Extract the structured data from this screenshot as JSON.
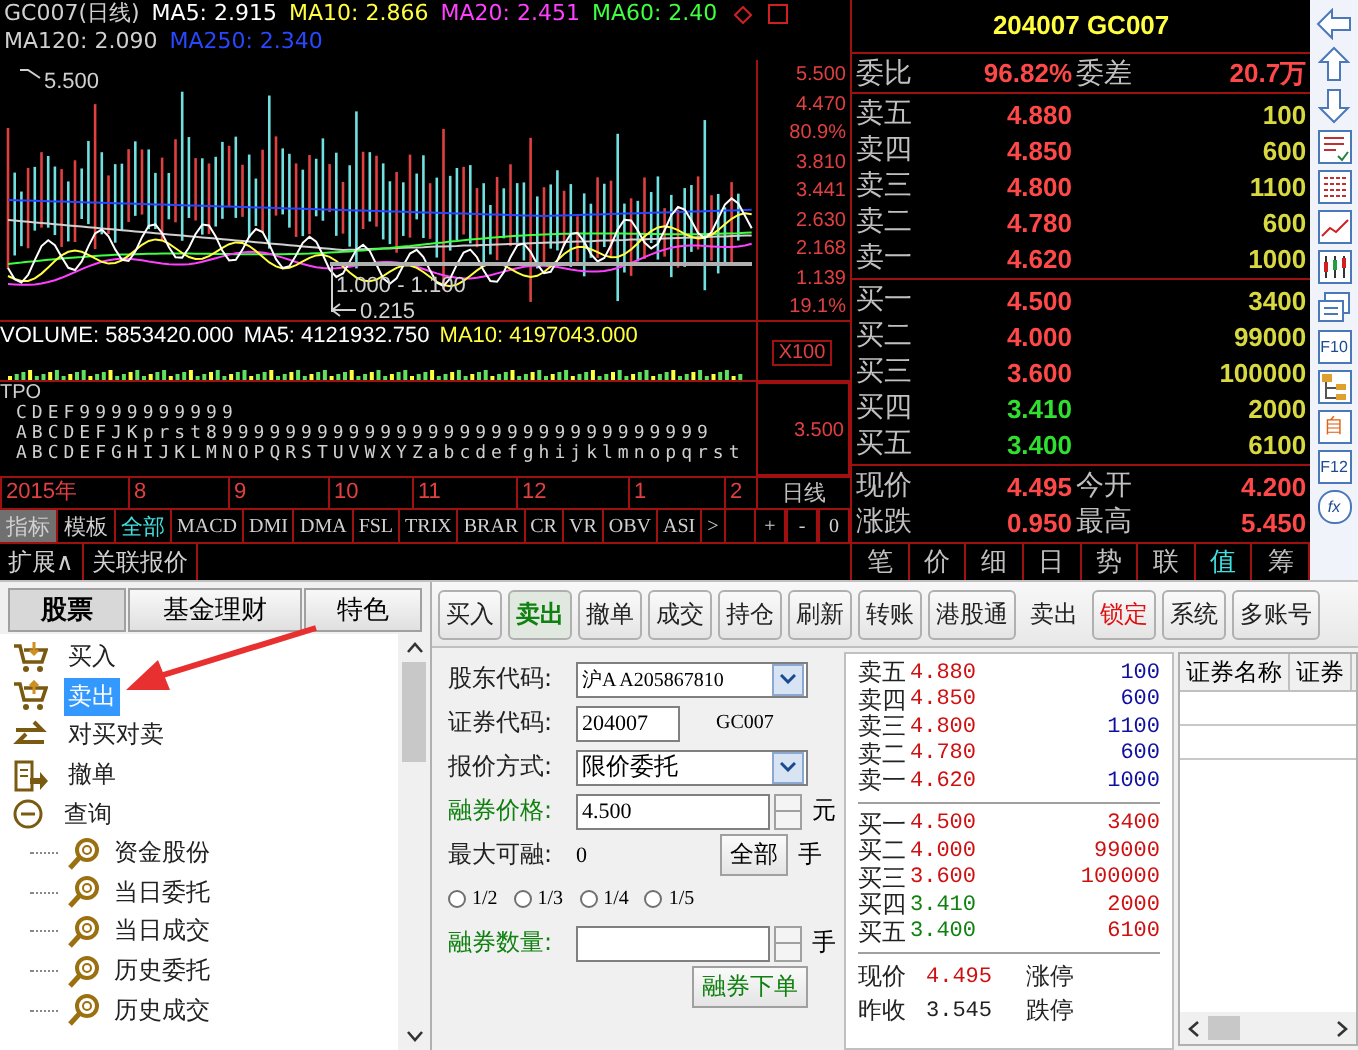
{
  "chart": {
    "legend_line1": [
      {
        "text": "GC007(日线)",
        "color": "#d0d0d0"
      },
      {
        "text": "MA5: 2.915",
        "color": "#ffffff"
      },
      {
        "text": "MA10: 2.866",
        "color": "#ffff40"
      },
      {
        "text": "MA20: 2.451",
        "color": "#ff40ff"
      },
      {
        "text": "MA60: 2.40",
        "color": "#40ff40"
      }
    ],
    "legend_line2": [
      {
        "text": "MA120: 2.090",
        "color": "#d0d0d0"
      },
      {
        "text": "MA250: 2.340",
        "color": "#2848ff"
      }
    ],
    "peak_label": "5.500",
    "range_label": "1.000 - 1.100",
    "range_sub_label": "0.215",
    "axis_labels": [
      "5.500",
      "4.470",
      "80.9%",
      "3.810",
      "3.441",
      "2.630",
      "2.168",
      "1.139",
      "19.1%"
    ],
    "volume_legend": [
      {
        "text": "VOLUME: 5853420.000",
        "color": "#ffffff"
      },
      {
        "text": "MA5: 4121932.750",
        "color": "#ffffff"
      },
      {
        "text": "MA10: 4197043.000",
        "color": "#ffff40"
      }
    ],
    "volume_scale": "X100",
    "tpo_title": "TPO",
    "tpo_lines": [
      "CDEF9999999999",
      "ABCDEFJKprst89999999999999999999999999999999",
      "ABCDEFGHIJKLMNOPQRSTUVWXYZabcdefghijklmnopqrst"
    ],
    "tpo_axis_label": "3.500",
    "time_axis": [
      "2015年",
      "8",
      "9",
      "10",
      "11",
      "12",
      "1",
      "2"
    ],
    "period": "日线",
    "mode_tabs": [
      {
        "label": "指标",
        "selected": true
      },
      {
        "label": "模板",
        "selected": false
      }
    ],
    "indicator_tabs": [
      {
        "label": "全部",
        "selected": true
      },
      {
        "label": "MACD",
        "selected": false
      },
      {
        "label": "DMI",
        "selected": false
      },
      {
        "label": "DMA",
        "selected": false
      },
      {
        "label": "FSL",
        "selected": false
      },
      {
        "label": "TRIX",
        "selected": false
      },
      {
        "label": "BRAR",
        "selected": false
      },
      {
        "label": "CR",
        "selected": false
      },
      {
        "label": "VR",
        "selected": false
      },
      {
        "label": "OBV",
        "selected": false
      },
      {
        "label": "ASI",
        "selected": false
      }
    ],
    "more": ">",
    "zoom_buttons": [
      "+",
      "-",
      "0"
    ],
    "extension_tabs": [
      "扩展∧",
      "关联报价"
    ]
  },
  "quote": {
    "title": "204007 GC007",
    "ratio_label": "委比",
    "ratio": "96.82%",
    "diff_label": "委差",
    "diff": "20.7万",
    "asks": [
      {
        "label": "卖五",
        "price": "4.880",
        "volume": "100",
        "rising": true
      },
      {
        "label": "卖四",
        "price": "4.850",
        "volume": "600",
        "rising": true
      },
      {
        "label": "卖三",
        "price": "4.800",
        "volume": "1100",
        "rising": true
      },
      {
        "label": "卖二",
        "price": "4.780",
        "volume": "600",
        "rising": true
      },
      {
        "label": "卖一",
        "price": "4.620",
        "volume": "1000",
        "rising": true
      }
    ],
    "bids": [
      {
        "label": "买一",
        "price": "4.500",
        "volume": "3400",
        "rising": true
      },
      {
        "label": "买二",
        "price": "4.000",
        "volume": "99000",
        "rising": true
      },
      {
        "label": "买三",
        "price": "3.600",
        "volume": "100000",
        "rising": true
      },
      {
        "label": "买四",
        "price": "3.410",
        "volume": "2000",
        "rising": false
      },
      {
        "label": "买五",
        "price": "3.400",
        "volume": "6100",
        "rising": false
      }
    ],
    "stats": [
      {
        "label": "现价",
        "value": "4.495",
        "rising": true,
        "label2": "今开",
        "value2": "4.200",
        "rising2": true
      },
      {
        "label": "涨跌",
        "value": "0.950",
        "rising": true,
        "label2": "最高",
        "value2": "5.450",
        "rising2": true
      }
    ],
    "tabs": [
      {
        "label": "笔",
        "selected": false
      },
      {
        "label": "价",
        "selected": false
      },
      {
        "label": "细",
        "selected": false
      },
      {
        "label": "日",
        "selected": false
      },
      {
        "label": "势",
        "selected": false
      },
      {
        "label": "联",
        "selected": false
      },
      {
        "label": "值",
        "selected": true
      },
      {
        "label": "筹",
        "selected": false
      }
    ]
  },
  "side_toolbar": {
    "text_buttons": [
      "F10",
      "自",
      "F12",
      "fx"
    ]
  },
  "nav": {
    "tabs": [
      {
        "label": "股票",
        "selected": true
      },
      {
        "label": "基金理财",
        "selected": false
      },
      {
        "label": "特色",
        "selected": false
      }
    ],
    "tree": [
      {
        "label": "买入",
        "kind": "buy",
        "selected": false
      },
      {
        "label": "卖出",
        "kind": "sell",
        "selected": true
      },
      {
        "label": "对买对卖",
        "kind": "swap",
        "selected": false
      },
      {
        "label": "撤单",
        "kind": "cancel",
        "selected": false
      },
      {
        "label": "查询",
        "kind": "folder",
        "selected": false,
        "expanded": true,
        "children": [
          {
            "label": "资金股份",
            "kind": "search",
            "selected": false
          },
          {
            "label": "当日委托",
            "kind": "search",
            "selected": false
          },
          {
            "label": "当日成交",
            "kind": "search",
            "selected": false
          },
          {
            "label": "历史委托",
            "kind": "search",
            "selected": false
          },
          {
            "label": "历史成交",
            "kind": "search",
            "selected": false
          }
        ]
      }
    ]
  },
  "toolbar": [
    {
      "label": "买入",
      "kind": "button",
      "selected": false
    },
    {
      "label": "卖出",
      "kind": "button",
      "selected": true
    },
    {
      "label": "撤单",
      "kind": "button",
      "selected": false
    },
    {
      "label": "成交",
      "kind": "button",
      "selected": false
    },
    {
      "label": "持仓",
      "kind": "button",
      "selected": false
    },
    {
      "label": "刷新",
      "kind": "button",
      "selected": false
    },
    {
      "label": "转账",
      "kind": "button",
      "selected": false
    },
    {
      "label": "港股通",
      "kind": "button",
      "selected": false
    },
    {
      "label": "卖出",
      "kind": "text",
      "selected": false
    },
    {
      "label": "锁定",
      "kind": "alert",
      "selected": false
    },
    {
      "label": "系统",
      "kind": "button",
      "selected": false
    },
    {
      "label": "多账号",
      "kind": "button",
      "selected": false
    }
  ],
  "order_form": {
    "account_label": "股东代码:",
    "account": "沪A A205867810",
    "code_label": "证券代码:",
    "code": "204007",
    "code_name": "GC007",
    "price_type_label": "报价方式:",
    "price_type": "限价委托",
    "price_label": "融券价格:",
    "price": "4.500",
    "price_unit": "元",
    "max_label": "最大可融:",
    "max": "0",
    "all_button": "全部",
    "max_unit": "手",
    "fractions": [
      {
        "label": "1/2",
        "selected": false
      },
      {
        "label": "1/3",
        "selected": false
      },
      {
        "label": "1/4",
        "selected": false
      },
      {
        "label": "1/5",
        "selected": false
      }
    ],
    "qty_label": "融券数量:",
    "qty_unit": "手",
    "submit": "融券下单"
  },
  "mini_quote": {
    "asks": [
      {
        "label": "卖五",
        "price": "4.880",
        "volume": "100",
        "rising": true
      },
      {
        "label": "卖四",
        "price": "4.850",
        "volume": "600",
        "rising": true
      },
      {
        "label": "卖三",
        "price": "4.800",
        "volume": "1100",
        "rising": true
      },
      {
        "label": "卖二",
        "price": "4.780",
        "volume": "600",
        "rising": true
      },
      {
        "label": "卖一",
        "price": "4.620",
        "volume": "1000",
        "rising": true
      }
    ],
    "bids": [
      {
        "label": "买一",
        "price": "4.500",
        "volume": "3400",
        "rising": true
      },
      {
        "label": "买二",
        "price": "4.000",
        "volume": "99000",
        "rising": true
      },
      {
        "label": "买三",
        "price": "3.600",
        "volume": "100000",
        "rising": true
      },
      {
        "label": "买四",
        "price": "3.410",
        "volume": "2000",
        "rising": false
      },
      {
        "label": "买五",
        "price": "3.400",
        "volume": "6100",
        "rising": false
      }
    ],
    "last_label": "现价",
    "last": "4.495",
    "last_rising": true,
    "limit_up_label": "涨停",
    "prev_label": "昨收",
    "prev": "3.545",
    "limit_down_label": "跌停"
  },
  "holdings_table": {
    "columns": [
      "证券名称",
      "证券"
    ]
  }
}
